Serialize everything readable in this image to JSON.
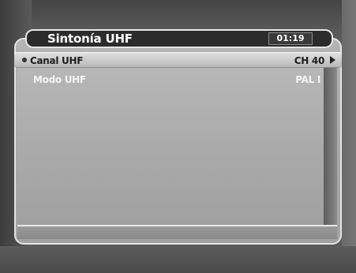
{
  "menu": {
    "title": "Sintonía UHF",
    "clock": "01:19"
  },
  "rows": [
    {
      "label": "Canal UHF",
      "value": "CH 40",
      "selected": true
    },
    {
      "label": "Modo UHF",
      "value": "PAL I",
      "selected": false
    }
  ],
  "icons": {
    "selection": "bullet-icon",
    "next": "arrow-right-icon"
  }
}
